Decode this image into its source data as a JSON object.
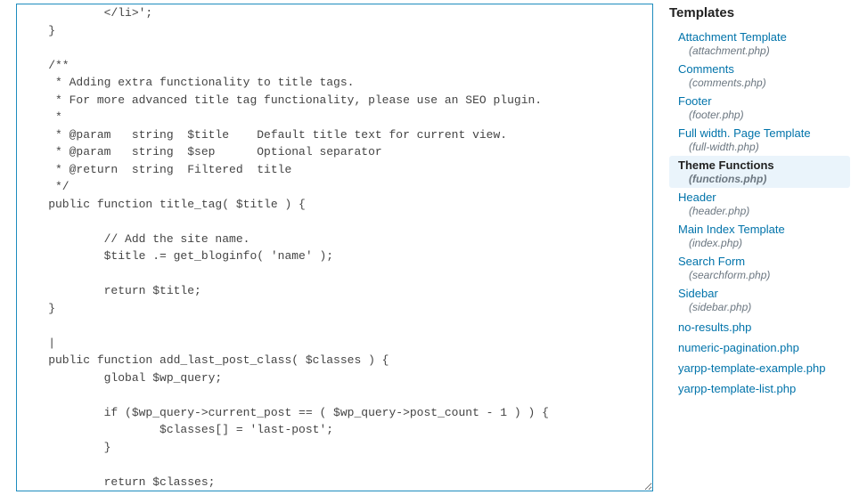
{
  "editor": {
    "content": "            </li>';\n    }\n\n    /**\n     * Adding extra functionality to title tags.\n     * For more advanced title tag functionality, please use an SEO plugin.\n     *\n     * @param   string  $title    Default title text for current view.\n     * @param   string  $sep      Optional separator\n     * @return  string  Filtered  title\n     */\n    public function title_tag( $title ) {\n\n            // Add the site name.\n            $title .= get_bloginfo( 'name' );\n\n            return $title;\n    }\n\n    |\n    public function add_last_post_class( $classes ) {\n            global $wp_query;\n\n            if ($wp_query->current_post == ( $wp_query->post_count - 1 ) ) {\n                    $classes[] = 'last-post';\n            }\n\n            return $classes;\n    }\n"
  },
  "sidebar": {
    "heading": "Templates",
    "items": [
      {
        "label": "Attachment Template",
        "file": "(attachment.php)",
        "active": false
      },
      {
        "label": "Comments",
        "file": "(comments.php)",
        "active": false
      },
      {
        "label": "Footer",
        "file": "(footer.php)",
        "active": false
      },
      {
        "label": "Full width. Page Template",
        "file": "(full-width.php)",
        "active": false
      },
      {
        "label": "Theme Functions",
        "file": "(functions.php)",
        "active": true
      },
      {
        "label": "Header",
        "file": "(header.php)",
        "active": false
      },
      {
        "label": "Main Index Template",
        "file": "(index.php)",
        "active": false
      },
      {
        "label": "Search Form",
        "file": "(searchform.php)",
        "active": false
      },
      {
        "label": "Sidebar",
        "file": "(sidebar.php)",
        "active": false
      },
      {
        "label": "no-results.php",
        "file": "",
        "active": false
      },
      {
        "label": "numeric-pagination.php",
        "file": "",
        "active": false
      },
      {
        "label": "yarpp-template-example.php",
        "file": "",
        "active": false
      },
      {
        "label": "yarpp-template-list.php",
        "file": "",
        "active": false
      }
    ]
  }
}
